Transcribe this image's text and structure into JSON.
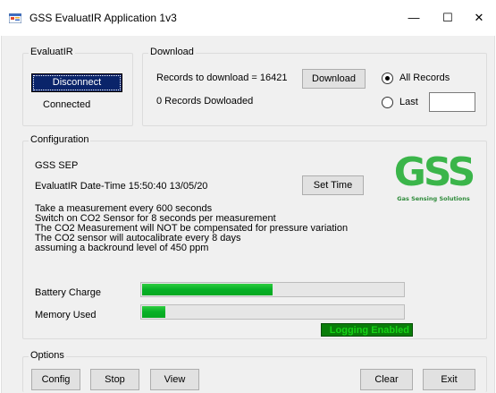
{
  "window": {
    "title": "GSS EvaluatIR Application 1v3",
    "minimize": "—",
    "maximize": "☐",
    "close": "✕"
  },
  "evaluatir_group": {
    "legend": "EvaluatIR",
    "disconnect_label": "Disconnect",
    "status": "Connected"
  },
  "download_group": {
    "legend": "Download",
    "records_text": "Records to download = 16421",
    "download_label": "Download",
    "downloaded_text": "0 Records Dowloaded",
    "all_records_label": "All Records",
    "last_label": "Last",
    "last_value": "",
    "selected": "All Records"
  },
  "configuration_group": {
    "legend": "Configuration",
    "device": "GSS SEP",
    "datetime": "EvaluatIR Date-Time 15:50:40 13/05/20",
    "set_time_label": "Set Time",
    "logo_text": "GSS",
    "logo_subtitle": "Gas Sensing Solutions",
    "lines": [
      "Take a measurement every 600 seconds",
      "Switch on CO2 Sensor for 8 seconds per measurement",
      "The CO2 Measurement will NOT be compensated for pressure variation",
      "The CO2 sensor will autocalibrate every 8 days",
      "assuming a backround level of 450 ppm"
    ],
    "battery_label": "Battery Charge",
    "battery_level": 0.5,
    "memory_label": "Memory Used",
    "memory_level": 0.09,
    "logging_status": "Logging Enabled"
  },
  "options_group": {
    "legend": "Options",
    "config_label": "Config",
    "stop_label": "Stop",
    "view_label": "View",
    "clear_label": "Clear",
    "exit_label": "Exit"
  },
  "colors": {
    "logo_green": "#3bb54a",
    "progress_green": "#06b025",
    "logging_bg": "#0a7d0a",
    "disconnect_bg": "#0a246a"
  }
}
